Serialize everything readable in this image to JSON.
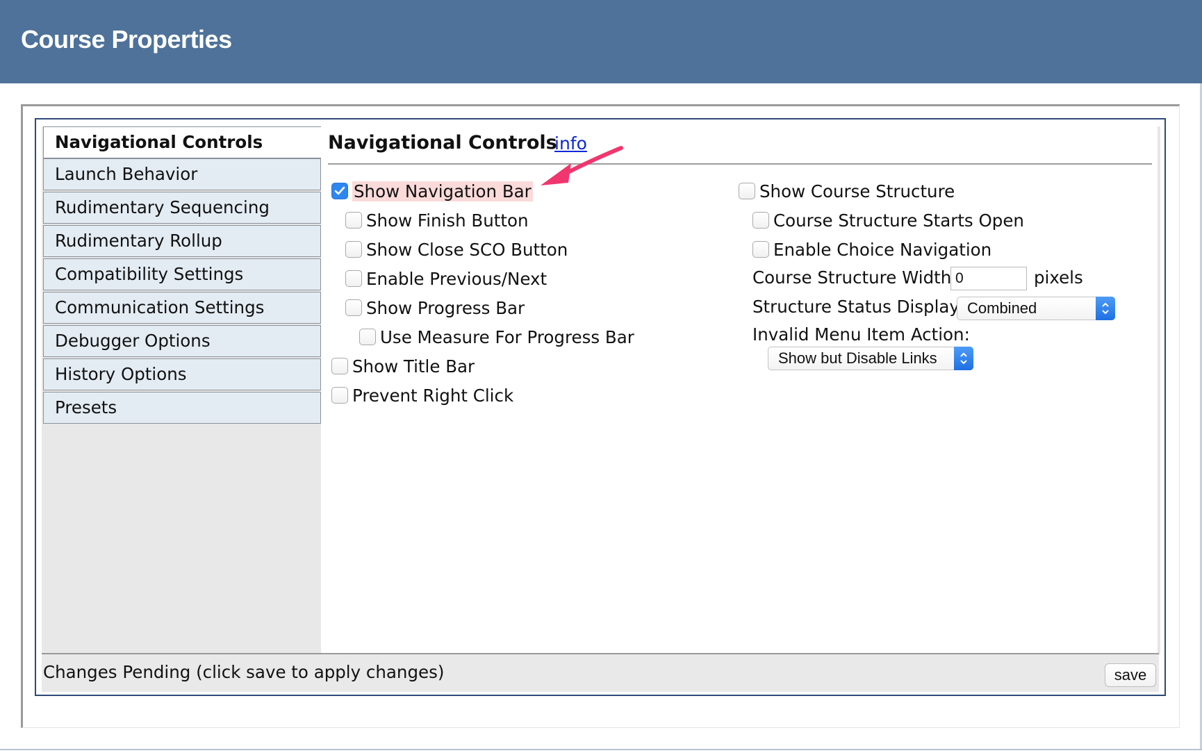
{
  "header": {
    "title": "Course Properties"
  },
  "sidebar": {
    "items": [
      {
        "label": "Navigational Controls",
        "active": true
      },
      {
        "label": "Launch Behavior",
        "active": false
      },
      {
        "label": "Rudimentary Sequencing",
        "active": false
      },
      {
        "label": "Rudimentary Rollup",
        "active": false
      },
      {
        "label": "Compatibility Settings",
        "active": false
      },
      {
        "label": "Communication Settings",
        "active": false
      },
      {
        "label": "Debugger Options",
        "active": false
      },
      {
        "label": "History Options",
        "active": false
      },
      {
        "label": "Presets",
        "active": false
      }
    ]
  },
  "section": {
    "title": "Navigational Controls",
    "info_link": "info"
  },
  "left_options": [
    {
      "label": "Show Navigation Bar",
      "checked": true,
      "highlighted": true
    },
    {
      "label": "Show Finish Button",
      "checked": false
    },
    {
      "label": "Show Close SCO Button",
      "checked": false
    },
    {
      "label": "Enable Previous/Next",
      "checked": false
    },
    {
      "label": "Show Progress Bar",
      "checked": false
    },
    {
      "label": "Use Measure For Progress Bar",
      "checked": false
    },
    {
      "label": "Show Title Bar",
      "checked": false
    },
    {
      "label": "Prevent Right Click",
      "checked": false
    }
  ],
  "right_options": [
    {
      "label": "Show Course Structure",
      "checked": false
    },
    {
      "label": "Course Structure Starts Open",
      "checked": false
    },
    {
      "label": "Enable Choice Navigation",
      "checked": false
    }
  ],
  "structure_width": {
    "label": "Course Structure Width:",
    "value": "0",
    "unit": "pixels"
  },
  "status_display": {
    "label": "Structure Status Display:",
    "selected": "Combined"
  },
  "invalid_action": {
    "label": "Invalid Menu Item Action:",
    "selected": "Show but Disable Links"
  },
  "status_bar": {
    "message": "Changes Pending (click save to apply changes)",
    "save_label": "save"
  },
  "colors": {
    "header": "#4e7299",
    "panel_border": "#2d4a78",
    "link": "#0b28d8",
    "checkbox_checked": "#2e86f0",
    "annotation_arrow": "#f0366e",
    "highlight": "#fbdada"
  },
  "annotation": {
    "icon": "pointer-arrow-icon"
  }
}
